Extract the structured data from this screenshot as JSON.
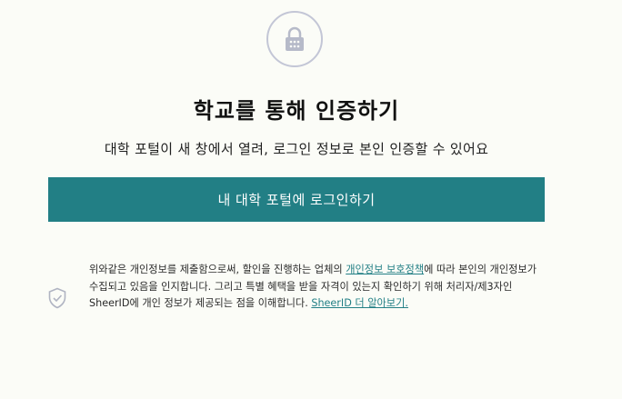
{
  "header": {
    "lock_icon": "lock-icon",
    "title": "학교를 통해 인증하기",
    "subtitle": "대학 포털이 새 창에서 열려, 로그인 정보로 본인 인증할 수 있어요"
  },
  "actions": {
    "login_label": "내 대학 포털에 로그인하기",
    "accent_color": "#227f85"
  },
  "consent": {
    "shield_icon": "shield-check-icon",
    "text_before": "위와같은 개인정보를 제출함으로써, 할인을 진행하는 업체의 ",
    "privacy_link": "개인정보 보호정책",
    "text_middle": "에 따라 본인의 개인정보가 수집되고 있음을 인지합니다. 그리고 특별 혜택을 받을 자격이 있는지 확인하기 위해 처리자/제3자인 SheerID에 개인 정보가 제공되는 점을 이해합니다. ",
    "learn_more_link": "SheerID 더 알아보기."
  }
}
